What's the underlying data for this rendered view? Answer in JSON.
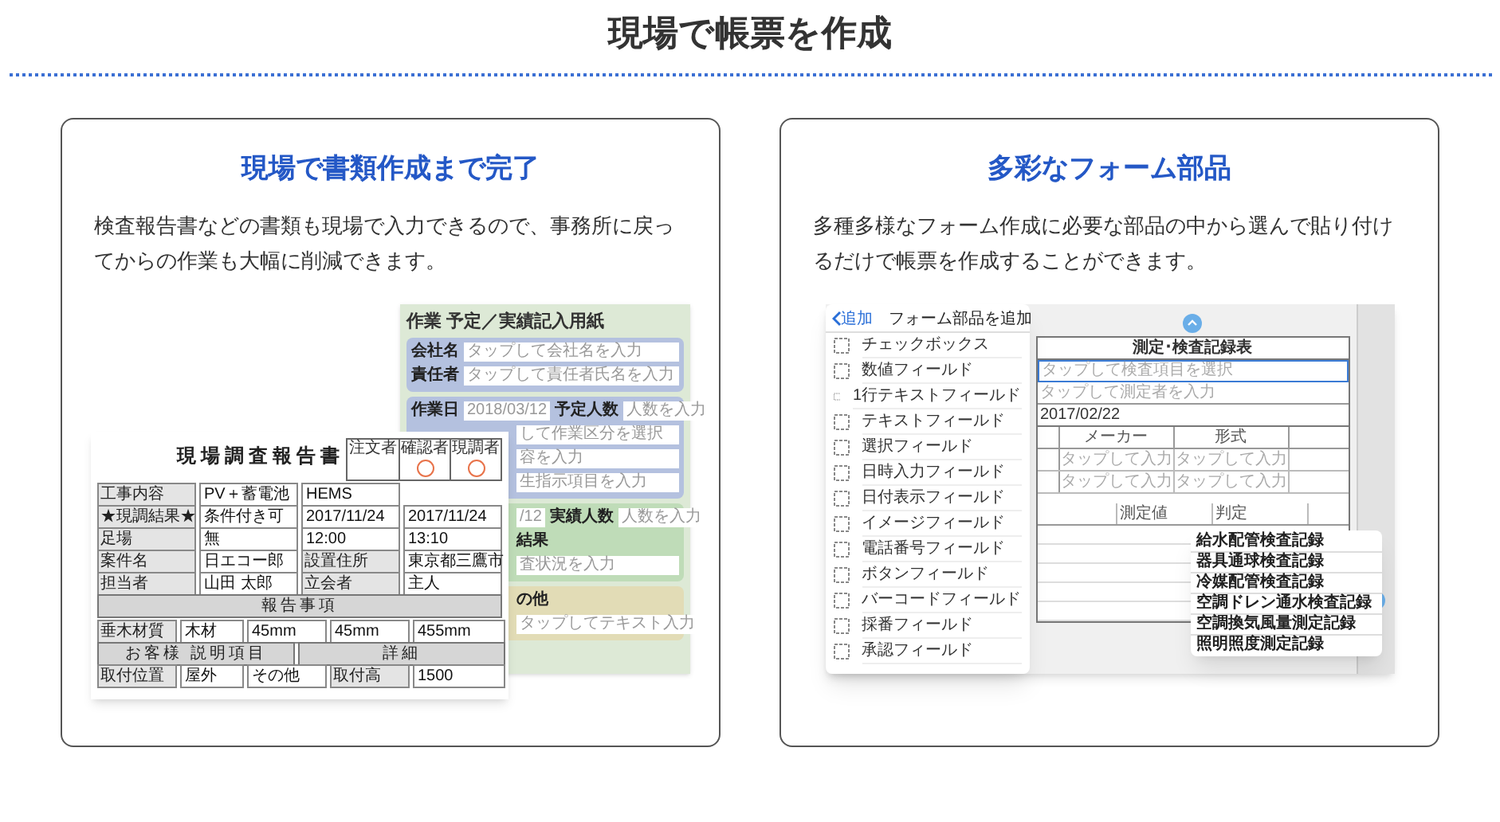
{
  "page_title": "現場で帳票を作成",
  "cards": [
    {
      "kind": "forms",
      "title": "現場で書類作成まで完了",
      "text": "検査報告書などの書類も現場で入力できるので、事務所に戻ってからの作業も大幅に削減できます。",
      "back_form": {
        "title": "作業 予定／実績記入用紙",
        "sections": [
          {
            "color": "#b4c1df",
            "rows": [
              [
                {
                  "kind": "label",
                  "text": "会社名"
                },
                {
                  "kind": "field",
                  "text": "タップして会社名を入力"
                }
              ],
              [
                {
                  "kind": "label",
                  "text": "責任者"
                },
                {
                  "kind": "field",
                  "text": "タップして責任者氏名を入力"
                }
              ]
            ]
          },
          {
            "color": "#b4c1df",
            "rows": [
              [
                {
                  "kind": "label",
                  "text": "作業日"
                },
                {
                  "kind": "field",
                  "text": "2018/03/12"
                },
                {
                  "kind": "label",
                  "text": "予定人数"
                },
                {
                  "kind": "field",
                  "text": "人数を入力"
                }
              ],
              [
                {
                  "kind": "field",
                  "text": "して作業区分を選択"
                }
              ],
              [
                {
                  "kind": "field",
                  "text": "容を入力"
                }
              ],
              [
                {
                  "kind": "field",
                  "text": "生指示項目を入力"
                }
              ]
            ]
          },
          {
            "color": "#bfdcb8",
            "rows": [
              [
                {
                  "kind": "field",
                  "text": "/12"
                },
                {
                  "kind": "label",
                  "text": "実績人数"
                },
                {
                  "kind": "field",
                  "text": "人数を入力"
                }
              ],
              [
                {
                  "kind": "label",
                  "text": "結果"
                }
              ],
              [
                {
                  "kind": "field",
                  "text": "査状況を入力"
                }
              ]
            ]
          },
          {
            "color": "#e2dcb6",
            "rows": [
              [
                {
                  "kind": "label",
                  "text": "の他"
                }
              ],
              [
                {
                  "kind": "field",
                  "text": "タップしてテキスト入力"
                }
              ]
            ]
          }
        ]
      },
      "report": {
        "title": "現場調査報告書",
        "stamps": [
          "注文者",
          "確認者",
          "現調者"
        ],
        "info_rows": [
          [
            {
              "kind": "label",
              "text": "工事内容"
            },
            {
              "kind": "value",
              "text": "PV＋蓄電池"
            },
            {
              "kind": "value",
              "text": "HEMS"
            }
          ],
          [
            {
              "kind": "label",
              "text": "★現調結果★"
            },
            {
              "kind": "value",
              "text": "条件付き可"
            },
            {
              "kind": "value",
              "text": "2017/11/24"
            },
            {
              "kind": "value",
              "text": "2017/11/24"
            }
          ],
          [
            {
              "kind": "label",
              "text": "足場"
            },
            {
              "kind": "value",
              "text": "無"
            },
            {
              "kind": "value",
              "text": "12:00"
            },
            {
              "kind": "value",
              "text": "13:10"
            }
          ],
          [
            {
              "kind": "label",
              "text": "案件名"
            },
            {
              "kind": "value",
              "text": "日エコー郎"
            },
            {
              "kind": "label",
              "text": "設置住所"
            },
            {
              "kind": "value",
              "text": "東京都三鷹市"
            }
          ],
          [
            {
              "kind": "label",
              "text": "担当者"
            },
            {
              "kind": "value",
              "text": "山田 太郎"
            },
            {
              "kind": "label",
              "text": "立会者"
            },
            {
              "kind": "value",
              "text": "主人"
            }
          ]
        ],
        "section_header": "報告事項",
        "measure_row": [
          {
            "kind": "label",
            "text": "垂木材質"
          },
          {
            "kind": "value",
            "text": "木材"
          },
          {
            "kind": "value",
            "text": "45mm"
          },
          {
            "kind": "value",
            "text": "45mm"
          },
          {
            "kind": "value",
            "text": "455mm"
          }
        ],
        "customer_headers": [
          "お客様 説明項目",
          "詳細"
        ],
        "install_row": [
          {
            "kind": "label",
            "text": "取付位置"
          },
          {
            "kind": "value",
            "text": "屋外"
          },
          {
            "kind": "value",
            "text": "その他"
          },
          {
            "kind": "label",
            "text": "取付高"
          },
          {
            "kind": "value",
            "text": "1500"
          }
        ]
      }
    },
    {
      "kind": "parts",
      "title": "多彩なフォーム部品",
      "text": "多種多様なフォーム作成に必要な部品の中から選んで貼り付けるだけで帳票を作成することができます。",
      "menu": {
        "back": "追加",
        "title": "フォーム部品を追加",
        "items": [
          "チェックボックス",
          "数値フィールド",
          "1行テキストフィールド",
          "テキストフィールド",
          "選択フィールド",
          "日時入力フィールド",
          "日付表示フィールド",
          "イメージフィールド",
          "電話番号フィールド",
          "ボタンフィールド",
          "バーコードフィールド",
          "採番フィールド",
          "承認フィールド"
        ]
      },
      "sheet": {
        "title": "測定･検査記録表",
        "select_placeholder": "タップして検査項目を選択",
        "tester_placeholder": "タップして測定者を入力",
        "date": "2017/02/22",
        "columns": [
          "メーカー",
          "形式"
        ],
        "rows": [
          [
            "タップして入力",
            "タップして入力"
          ],
          [
            "タップして入力",
            "タップして入力"
          ]
        ],
        "columns_2": [
          "測定値",
          "判定"
        ]
      },
      "dropdown": [
        "給水配管検査記録",
        "器具通球検査記録",
        "冷媒配管検査記録",
        "空調ドレン通水検査記録",
        "空調換気風量測定記録",
        "照明照度測定記録"
      ]
    }
  ]
}
